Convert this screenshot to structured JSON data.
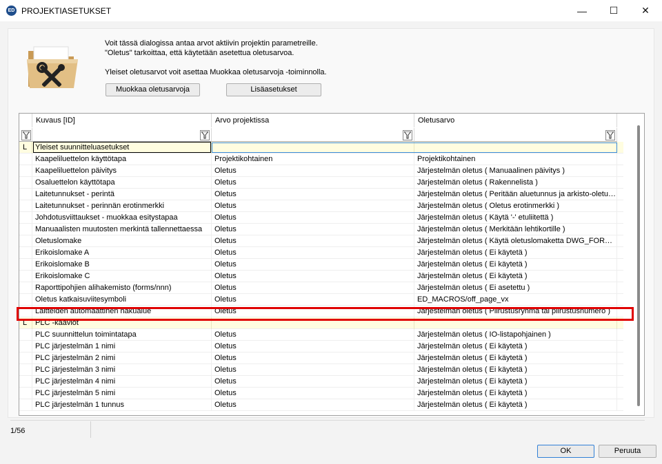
{
  "window": {
    "title": "PROJEKTIASETUKSET",
    "app_icon_text": "ED",
    "minimize_glyph": "—",
    "maximize_glyph": "☐",
    "close_glyph": "✕"
  },
  "intro": {
    "line1": "Voit tässä dialogissa antaa arvot aktiivin projektin parametreille.",
    "line2": "\"Oletus\" tarkoittaa, että käytetään asetettua oletusarvoa.",
    "line3": "Yleiset oletusarvot voit asettaa Muokkaa oletusarvoja -toiminnolla."
  },
  "buttons": {
    "edit_defaults": "Muokkaa oletusarvoja",
    "extra_settings": "Lisäasetukset",
    "ok": "OK",
    "cancel": "Peruuta"
  },
  "grid": {
    "columns": [
      "Kuvaus [ID]",
      "Arvo projektissa",
      "Oletusarvo"
    ],
    "rows": [
      {
        "marker": "L",
        "group": true,
        "c1": "Yleiset suunnitteluasetukset",
        "c2": "",
        "c3": ""
      },
      {
        "marker": "",
        "group": false,
        "c1": "Kaapeliluettelon käyttötapa",
        "c2": "Projektikohtainen",
        "c3": "Projektikohtainen"
      },
      {
        "marker": "",
        "group": false,
        "c1": "Kaapeliluettelon päivitys",
        "c2": "Oletus",
        "c3": "Järjestelmän oletus ( Manuaalinen päivitys )"
      },
      {
        "marker": "",
        "group": false,
        "c1": "Osaluettelon käyttötapa",
        "c2": "Oletus",
        "c3": "Järjestelmän oletus ( Rakennelista )"
      },
      {
        "marker": "",
        "group": false,
        "c1": "Laitetunnukset - perintä",
        "c2": "Oletus",
        "c3": "Järjestelmän oletus ( Peritään aluetunnus ja arkisto-oletus )"
      },
      {
        "marker": "",
        "group": false,
        "c1": "Laitetunnukset - perinnän erotinmerkki",
        "c2": "Oletus",
        "c3": "Järjestelmän oletus ( Oletus erotinmerkki )"
      },
      {
        "marker": "",
        "group": false,
        "c1": "Johdotusviittaukset - muokkaa esitystapaa",
        "c2": "Oletus",
        "c3": "Järjestelmän oletus ( Käytä '-' etuliitettä )"
      },
      {
        "marker": "",
        "group": false,
        "c1": "Manuaalisten muutosten merkintä tallennettaessa",
        "c2": "Oletus",
        "c3": "Järjestelmän oletus ( Merkitään lehtikortille )"
      },
      {
        "marker": "",
        "group": false,
        "c1": "Oletuslomake",
        "c2": "Oletus",
        "c3": "Järjestelmän oletus ( Käytä oletuslomaketta DWG_FORMS-..."
      },
      {
        "marker": "",
        "group": false,
        "c1": "Erikoislomake A",
        "c2": "Oletus",
        "c3": "Järjestelmän oletus ( Ei käytetä )"
      },
      {
        "marker": "",
        "group": false,
        "c1": "Erikoislomake B",
        "c2": "Oletus",
        "c3": "Järjestelmän oletus ( Ei käytetä )"
      },
      {
        "marker": "",
        "group": false,
        "c1": "Erikoislomake C",
        "c2": "Oletus",
        "c3": "Järjestelmän oletus ( Ei käytetä )"
      },
      {
        "marker": "",
        "group": false,
        "c1": "Raporttipohjien alihakemisto (forms/nnn)",
        "c2": "Oletus",
        "c3": "Järjestelmän oletus ( Ei asetettu )"
      },
      {
        "marker": "",
        "group": false,
        "c1": "Oletus katkaisuviitesymboli",
        "c2": "Oletus",
        "c3": "ED_MACROS/off_page_vx"
      },
      {
        "marker": "",
        "group": false,
        "c1": "Laitteiden automaattinen hakualue",
        "c2": "Oletus",
        "c3": "Järjestelmän oletus ( Piirustusryhmä tai piirustusnumero )"
      },
      {
        "marker": "L",
        "group": true,
        "c1": "PLC -kaaviot",
        "c2": "",
        "c3": ""
      },
      {
        "marker": "",
        "group": false,
        "c1": "PLC suunnittelun toimintatapa",
        "c2": "Oletus",
        "c3": "Järjestelmän oletus ( IO-listapohjainen )"
      },
      {
        "marker": "",
        "group": false,
        "c1": "PLC järjestelmän 1 nimi",
        "c2": "Oletus",
        "c3": "Järjestelmän oletus ( Ei käytetä )"
      },
      {
        "marker": "",
        "group": false,
        "c1": "PLC järjestelmän 2 nimi",
        "c2": "Oletus",
        "c3": "Järjestelmän oletus ( Ei käytetä )"
      },
      {
        "marker": "",
        "group": false,
        "c1": "PLC järjestelmän 3 nimi",
        "c2": "Oletus",
        "c3": "Järjestelmän oletus ( Ei käytetä )"
      },
      {
        "marker": "",
        "group": false,
        "c1": "PLC järjestelmän 4 nimi",
        "c2": "Oletus",
        "c3": "Järjestelmän oletus ( Ei käytetä )"
      },
      {
        "marker": "",
        "group": false,
        "c1": "PLC järjestelmän 5 nimi",
        "c2": "Oletus",
        "c3": "Järjestelmän oletus ( Ei käytetä )"
      },
      {
        "marker": "",
        "group": false,
        "c1": "PLC järjestelmän 1 tunnus",
        "c2": "Oletus",
        "c3": "Järjestelmän oletus ( Ei käytetä )"
      }
    ]
  },
  "status": {
    "count": "1/56"
  },
  "colors": {
    "group_row": "#fffde0",
    "highlight": "#e00000",
    "folder": "#d9b57a"
  },
  "icons": [
    "app-icon",
    "folder-tools-icon",
    "filter-icon",
    "minimize-icon",
    "maximize-icon",
    "close-icon"
  ]
}
